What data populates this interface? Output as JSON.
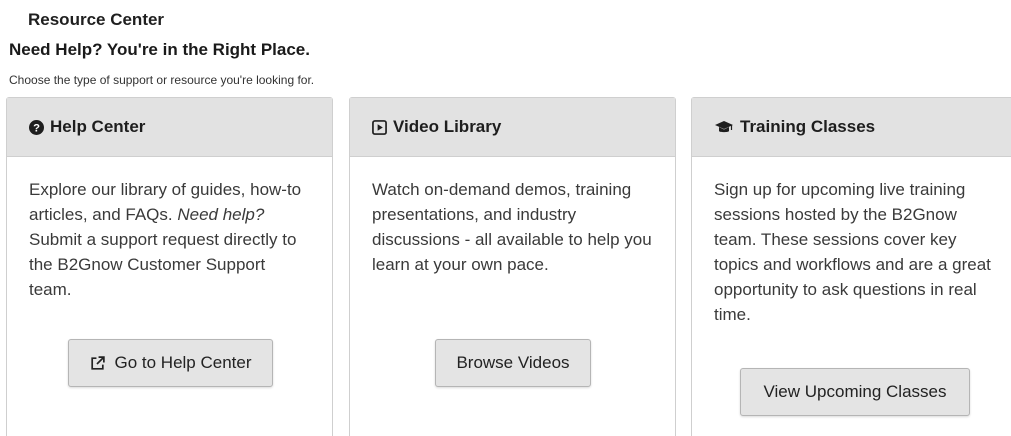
{
  "page": {
    "title": "Resource Center",
    "heading": "Need Help? You're in the Right Place.",
    "subheading": "Choose the type of support or resource you're looking for."
  },
  "cards": [
    {
      "icon": "question-circle-icon",
      "title": "Help Center",
      "body_part1": "Explore our library of guides, how-to articles, and FAQs. ",
      "body_emphasis": "Need help?",
      "body_part2": " Submit a support request directly to the B2Gnow Customer Support team.",
      "button_icon": "external-link-icon",
      "button_label": "Go to Help Center"
    },
    {
      "icon": "play-square-icon",
      "title": "Video Library",
      "body": "Watch on-demand demos, training presentations, and industry discussions - all available to help you learn at your own pace.",
      "button_label": "Browse Videos"
    },
    {
      "icon": "graduation-cap-icon",
      "title": "Training Classes",
      "body": "Sign up for upcoming live training sessions hosted by the B2Gnow team. These sessions cover key topics and workflows and are a great opportunity to ask questions in real time.",
      "button_label": "View Upcoming Classes"
    }
  ]
}
